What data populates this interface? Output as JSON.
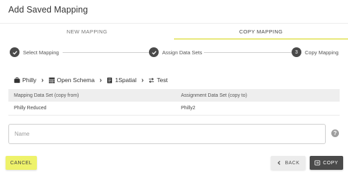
{
  "dialog": {
    "title": "Add Saved Mapping"
  },
  "tabs": [
    {
      "label": "NEW MAPPING",
      "active": false
    },
    {
      "label": "COPY MAPPING",
      "active": true
    }
  ],
  "stepper": {
    "steps": [
      {
        "label": "Select Mapping",
        "status": "complete",
        "icon": "check-icon"
      },
      {
        "label": "Assign Data Sets",
        "status": "complete",
        "icon": "check-icon"
      },
      {
        "label": "Copy Mapping",
        "status": "active",
        "number": "3"
      }
    ]
  },
  "breadcrumb": [
    {
      "label": "Philly",
      "icon": "briefcase-icon"
    },
    {
      "label": "Open Schema",
      "icon": "table-icon"
    },
    {
      "label": "1Spatial",
      "icon": "document-icon"
    },
    {
      "label": "Test",
      "icon": "swap-icon"
    }
  ],
  "table": {
    "headers": [
      "Mapping Data Set (copy from)",
      "Assignment Data Set (copy to)"
    ],
    "rows": [
      [
        "Philly Reduced",
        "Philly2"
      ]
    ]
  },
  "name_field": {
    "placeholder": "Name",
    "value": ""
  },
  "help": {
    "symbol": "?"
  },
  "buttons": {
    "cancel": "CANCEL",
    "back": "BACK",
    "copy": "COPY"
  },
  "colors": {
    "accent_yellow": "#eef26a",
    "dark": "#4a4a4a",
    "header_bg": "#eeeeee"
  }
}
